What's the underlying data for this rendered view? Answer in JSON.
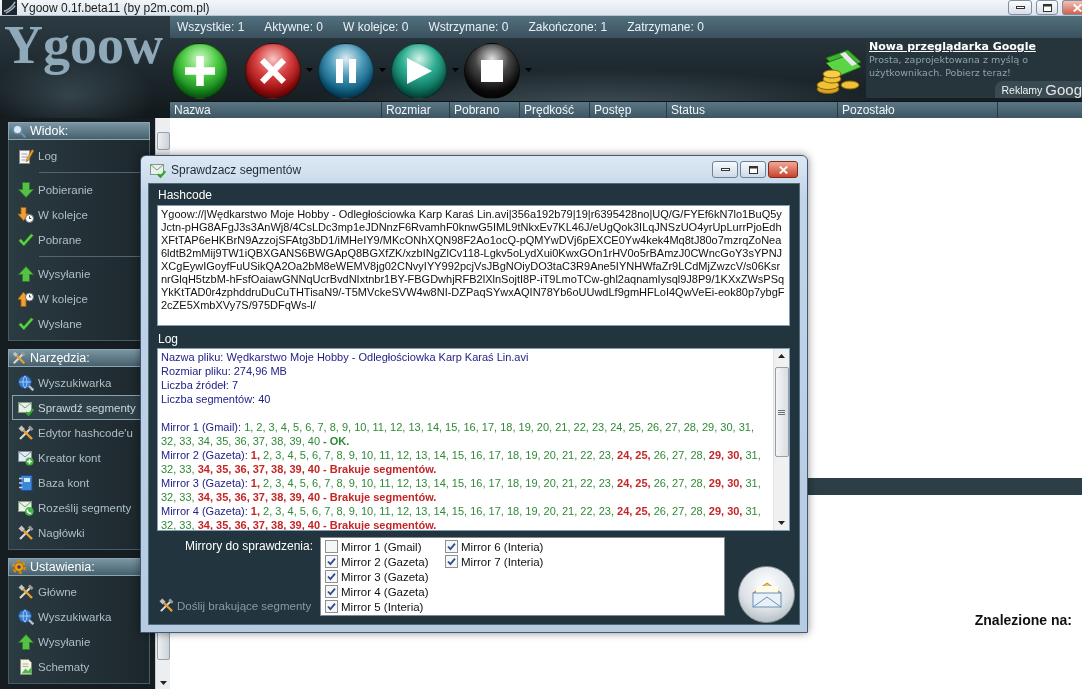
{
  "window": {
    "title": "Ygoow 0.1f.beta11 (by p2m.com.pl)"
  },
  "logo": "Ygoow",
  "counters": [
    "Wszystkie: 1",
    "Aktywne: 0",
    "W kolejce: 0",
    "Wstrzymane: 0",
    "Zakończone: 1",
    "Zatrzymane: 0"
  ],
  "toolbar": [
    {
      "kind": "add",
      "dropdown": false
    },
    {
      "kind": "remove",
      "dropdown": true
    },
    {
      "kind": "pause",
      "dropdown": true
    },
    {
      "kind": "resume",
      "dropdown": true
    },
    {
      "kind": "stop",
      "dropdown": true
    }
  ],
  "ad": {
    "headline": "Nowa przeglądarka Google",
    "body": "Prosta, zaprojektowana z myślą o użytkownikach. Pobierz teraz!",
    "label": "Reklamy",
    "brand": "Goog"
  },
  "columns": [
    "Nazwa",
    "Rozmiar",
    "Pobrano",
    "Prędkość",
    "Postęp",
    "Status",
    "Pozostało"
  ],
  "sidebar": {
    "sections": [
      {
        "title": "Widok:",
        "kind": "view",
        "groups": [
          {
            "items": [
              {
                "label": "Log",
                "kind": "log",
                "selected": false
              }
            ]
          },
          {
            "items": [
              {
                "label": "Pobieranie",
                "kind": "downloading",
                "selected": false
              },
              {
                "label": "W kolejce",
                "kind": "download-queue",
                "selected": false
              },
              {
                "label": "Pobrane",
                "kind": "downloaded",
                "selected": false
              }
            ]
          },
          {
            "items": [
              {
                "label": "Wysyłanie",
                "kind": "uploading",
                "selected": false
              },
              {
                "label": "W kolejce",
                "kind": "upload-queue",
                "selected": false
              },
              {
                "label": "Wysłane",
                "kind": "uploaded",
                "selected": false
              }
            ]
          }
        ]
      },
      {
        "title": "Narzędzia:",
        "kind": "tools",
        "groups": [
          {
            "items": [
              {
                "label": "Wyszukiwarka",
                "kind": "search-engine",
                "selected": false
              },
              {
                "label": "Sprawdź segmenty",
                "kind": "segment-check",
                "selected": true
              },
              {
                "label": "Edytor hashcode'u",
                "kind": "hashcode-editor",
                "selected": false
              },
              {
                "label": "Kreator kont",
                "kind": "account-creator",
                "selected": false
              },
              {
                "label": "Baza kont",
                "kind": "account-base",
                "selected": false
              },
              {
                "label": "Roześlij segmenty",
                "kind": "segment-send",
                "selected": false
              },
              {
                "label": "Nagłówki",
                "kind": "headers",
                "selected": false
              }
            ]
          }
        ]
      },
      {
        "title": "Ustawienia:",
        "kind": "settings",
        "groups": [
          {
            "items": [
              {
                "label": "Główne",
                "kind": "general",
                "selected": false
              },
              {
                "label": "Wyszukiwarka",
                "kind": "search-engine",
                "selected": false
              },
              {
                "label": "Wysyłanie",
                "kind": "uploading",
                "selected": false
              },
              {
                "label": "Schematy",
                "kind": "schemes",
                "selected": false
              }
            ]
          }
        ]
      }
    ]
  },
  "dialog": {
    "title": "Sprawdzacz segmentów",
    "hashcode": {
      "label": "Hashcode",
      "value": "Ygoow://|Wędkarstwo Moje Hobby - Odległościowka Karp Karaś Lin.avi|356a192b79|19|r6395428no|UQ/G/FYEf6kN7lo1BuQ5yJctn-pHG8AFgJ3s3AnWj8/4CsLDc3mp1eJDNnzF6RvamhF0knwG5IML9tNkxEv7KL46J/eUgQok3ILqJNSzUO4yrUpLurrPjoEdhXFtTAP6eHKBrN9AzzojSFAtg3bD1/iMHeIY9/MKcONhXQN98F2Ao1ocQ-pQMYwDVj6pEXCE0Yw4kek4Mq8tJ80o7mzrqZoNea6ldtB2mMij9TW1iQBXGANS6BWGApQ8BGXfZK/xzbINgZlCv118-Lgkv5oLydXui0KwxGOn1rHV0o5rBAmzJ0CWncGoY3sYPNJXCgEywIGoyfFuUSikQA2Oa2bM8eWEMV8jg02CNvyIYY992pcjVsJBgNOiyDO3taC3R9Ane5IYNHWfaZr9LCdMjZwzcV/s06KsrnrGlqH5tzbM-hFsfOaiawGNNqUcrBvdNIxtnbr1BY-FBGDwhjRFB2lXlnSojtI8P-iT9LmoTCw-ghl2aqnamIysql9J8P9/1KXxZWsPSqYkKtTAD0r4zphddruDuCuTHTisaN9/-T5MVckeSVW4w8NI-DZPaqSYwxAQIN78Yb6oUUwdLf9gmHFLoI4QwVeEi-eok80p7ybgF2cZE5XmbXVy7S/975DFqWs-l/"
    },
    "log": {
      "label": "Log",
      "info": [
        "Nazwa pliku: Wędkarstwo Moje Hobby - Odległościowka Karp Karaś Lin.avi",
        "Rozmiar pliku: 274,96 MB",
        "Liczba źródeł: 7",
        "Liczba segmentów: 40"
      ],
      "mirrors": [
        {
          "label": "Mirror 1 (Gmail):",
          "runs": [
            {
              "text": "1, 2, 3, 4, 5, 6, 7, 8, 9, 10, 11, 12, 13, 14, 15, 16, 17, 18, 19, 20, 21, 22, 23, 24, 25, 26, 27, 28, 29, 30, 31, 32, 33, 34, 35, 36, 37, 38, 39, 40",
              "kind": "present"
            },
            {
              "text": "- OK.",
              "kind": "result-ok"
            }
          ]
        },
        {
          "label": "Mirror 2 (Gazeta):",
          "runs": [
            {
              "text": "1,",
              "kind": "missing"
            },
            {
              "text": "2, 3, 4, 5, 6, 7, 8, 9, 10, 11, 12, 13, 14, 15, 16, 17, 18, 19, 20, 21, 22, 23,",
              "kind": "present"
            },
            {
              "text": "24, 25,",
              "kind": "missing"
            },
            {
              "text": "26, 27, 28,",
              "kind": "present"
            },
            {
              "text": "29, 30,",
              "kind": "missing"
            },
            {
              "text": "31, 32, 33,",
              "kind": "present"
            },
            {
              "text": "34, 35, 36, 37, 38, 39, 40",
              "kind": "missing"
            },
            {
              "text": "- Brakuje segmentów.",
              "kind": "result-missing"
            }
          ]
        },
        {
          "label": "Mirror 3 (Gazeta):",
          "runs": [
            {
              "text": "1,",
              "kind": "missing"
            },
            {
              "text": "2, 3, 4, 5, 6, 7, 8, 9, 10, 11, 12, 13, 14, 15, 16, 17, 18, 19, 20, 21, 22, 23,",
              "kind": "present"
            },
            {
              "text": "24, 25,",
              "kind": "missing"
            },
            {
              "text": "26, 27, 28,",
              "kind": "present"
            },
            {
              "text": "29, 30,",
              "kind": "missing"
            },
            {
              "text": "31, 32, 33,",
              "kind": "present"
            },
            {
              "text": "34, 35, 36, 37, 38, 39, 40",
              "kind": "missing"
            },
            {
              "text": "- Brakuje segmentów.",
              "kind": "result-missing"
            }
          ]
        },
        {
          "label": "Mirror 4 (Gazeta):",
          "runs": [
            {
              "text": "1,",
              "kind": "missing"
            },
            {
              "text": "2, 3, 4, 5, 6, 7, 8, 9, 10, 11, 12, 13, 14, 15, 16, 17, 18, 19, 20, 21, 22, 23,",
              "kind": "present"
            },
            {
              "text": "24, 25,",
              "kind": "missing"
            },
            {
              "text": "26, 27, 28,",
              "kind": "present"
            },
            {
              "text": "29, 30,",
              "kind": "missing"
            },
            {
              "text": "31, 32, 33,",
              "kind": "present"
            },
            {
              "text": "34, 35, 36, 37, 38, 39, 40",
              "kind": "missing"
            },
            {
              "text": "- Brakuje segmentów.",
              "kind": "result-missing"
            }
          ]
        }
      ]
    },
    "mirror_select": {
      "label": "Mirrory do sprawdzenia:",
      "items": [
        {
          "label": "Mirror 1 (Gmail)",
          "checked": false
        },
        {
          "label": "Mirror 2 (Gazeta)",
          "checked": true
        },
        {
          "label": "Mirror 3 (Gazeta)",
          "checked": true
        },
        {
          "label": "Mirror 4 (Gazeta)",
          "checked": true
        },
        {
          "label": "Mirror 5 (Interia)",
          "checked": true
        },
        {
          "label": "Mirror 6 (Interia)",
          "checked": true
        },
        {
          "label": "Mirror 7 (Interia)",
          "checked": true
        }
      ]
    },
    "resend": {
      "label": "Doślij brakujące segmenty",
      "disabled": true
    }
  },
  "details": {
    "label": "Znalezione na:"
  }
}
